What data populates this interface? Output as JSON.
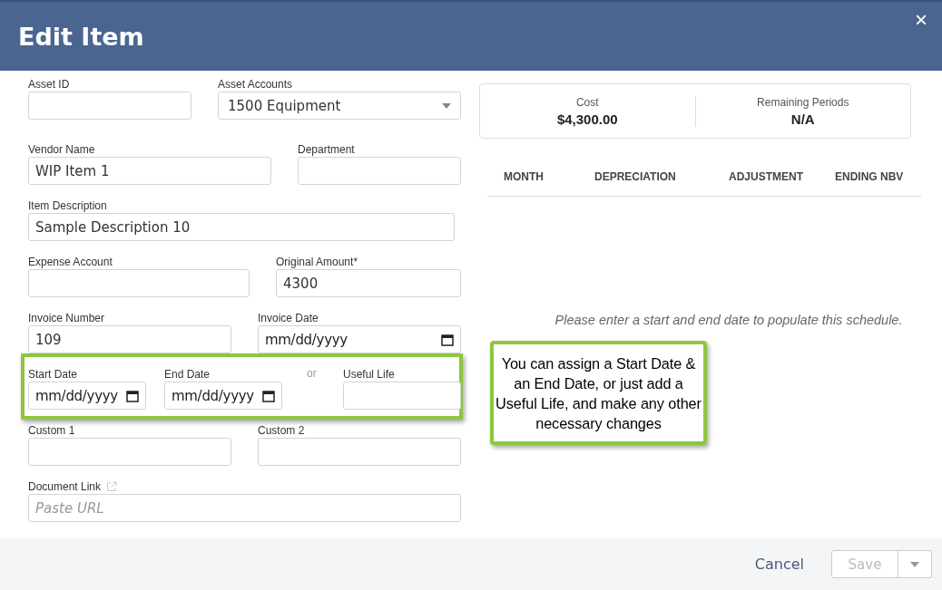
{
  "dialog": {
    "title": "Edit Item",
    "close": "×"
  },
  "form_rows": [
    {
      "highlighted": false,
      "fields": [
        {
          "kind": "text",
          "label": "Asset ID"
        },
        {
          "kind": "select",
          "label": "Asset Accounts",
          "value": "1500 Equipment"
        }
      ]
    },
    {
      "highlighted": false,
      "fields": [
        {
          "kind": "text",
          "label": "Vendor Name",
          "value": "WIP Item 1"
        },
        {
          "kind": "text",
          "label": "Department"
        }
      ]
    },
    {
      "highlighted": false,
      "fields": [
        {
          "kind": "text",
          "label": "Item Description",
          "value": "Sample Description 10"
        }
      ]
    },
    {
      "highlighted": false,
      "fields": [
        {
          "kind": "text",
          "label": "Expense Account"
        },
        {
          "kind": "text",
          "label": "Original Amount*",
          "value": "4300"
        }
      ]
    },
    {
      "highlighted": false,
      "fields": [
        {
          "kind": "text",
          "label": "Invoice Number",
          "value": "109"
        },
        {
          "kind": "date",
          "label": "Invoice Date",
          "placeholder": "mm/dd/yyyy"
        }
      ]
    },
    {
      "highlighted": true,
      "fields": [
        {
          "kind": "date",
          "label": "Start Date",
          "placeholder": "mm/dd/yyyy"
        },
        {
          "kind": "date",
          "label": "End Date",
          "placeholder": "mm/dd/yyyy"
        },
        {
          "kind": "separator",
          "label": "or"
        },
        {
          "kind": "text",
          "label": "Useful Life"
        }
      ]
    },
    {
      "highlighted": false,
      "fields": [
        {
          "kind": "text",
          "label": "Custom 1"
        },
        {
          "kind": "text",
          "label": "Custom 2"
        }
      ]
    },
    {
      "highlighted": false,
      "fields": [
        {
          "kind": "link",
          "label": "Document Link",
          "placeholder": "Paste URL"
        }
      ]
    }
  ],
  "summary": [
    {
      "label": "Cost",
      "value": "$4,300.00"
    },
    {
      "label": "Remaining Periods",
      "value": "N/A"
    }
  ],
  "schedule": {
    "columns": [
      "MONTH",
      "DEPRECIATION",
      "ADJUSTMENT",
      "ENDING NBV"
    ],
    "empty_message": "Please enter a start and end date to populate this schedule."
  },
  "callout": "You can assign a Start Date & an End Date, or just add a Useful Life, and make any other necessary changes",
  "footer": {
    "cancel": "Cancel",
    "save": "Save",
    "save_disabled": true
  }
}
